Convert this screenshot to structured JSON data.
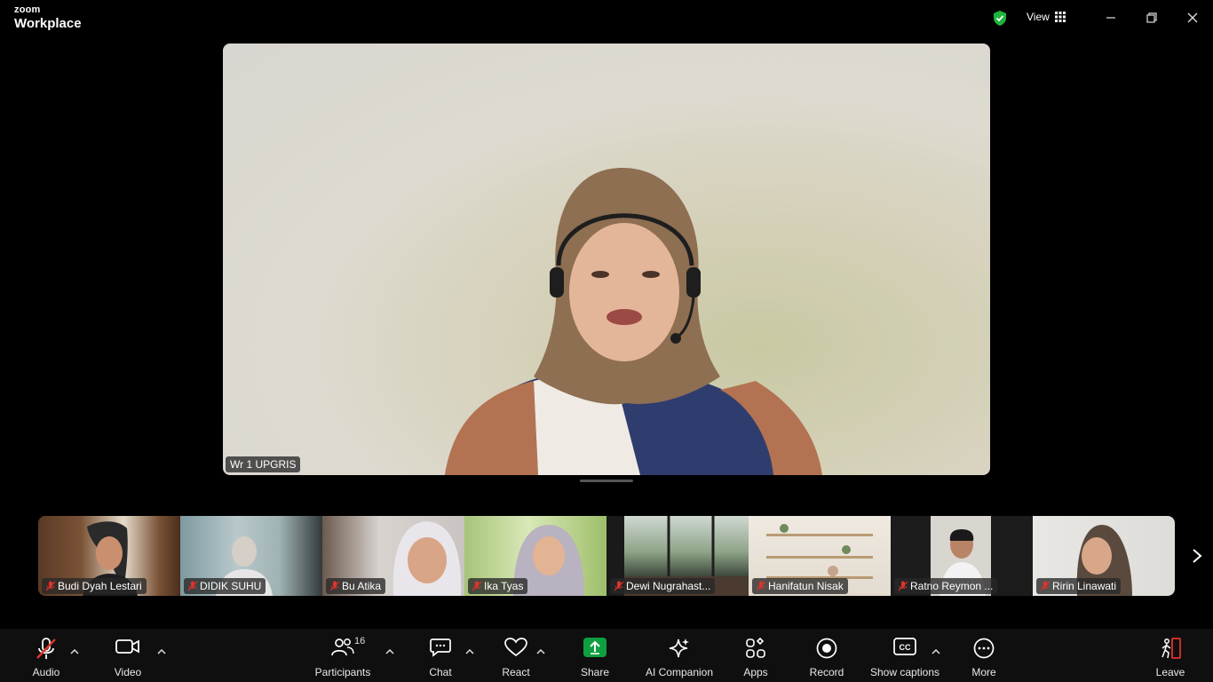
{
  "app": {
    "brand_small": "zoom",
    "brand_big": "Workplace"
  },
  "titlebar": {
    "view_label": "View"
  },
  "main_video": {
    "participant_name": "Wr 1 UPGRIS"
  },
  "participants_strip": [
    {
      "name": "Budi Dyah Lestari"
    },
    {
      "name": "DIDIK SUHU"
    },
    {
      "name": "Bu Atika"
    },
    {
      "name": "Ika Tyas"
    },
    {
      "name": "Dewi Nugrahast..."
    },
    {
      "name": "Hanifatun Nisak"
    },
    {
      "name": "Ratno Reymon ..."
    },
    {
      "name": "Ririn Linawati"
    }
  ],
  "toolbar": {
    "audio": "Audio",
    "video": "Video",
    "participants": "Participants",
    "participants_count": "16",
    "chat": "Chat",
    "react": "React",
    "share": "Share",
    "ai_companion": "AI Companion",
    "apps": "Apps",
    "record": "Record",
    "show_captions": "Show captions",
    "more": "More",
    "leave": "Leave"
  },
  "colors": {
    "share_green": "#0e9f3f",
    "shield_green": "#1fb53d",
    "mute_red": "#e0332b",
    "leave_red": "#e0332b"
  }
}
